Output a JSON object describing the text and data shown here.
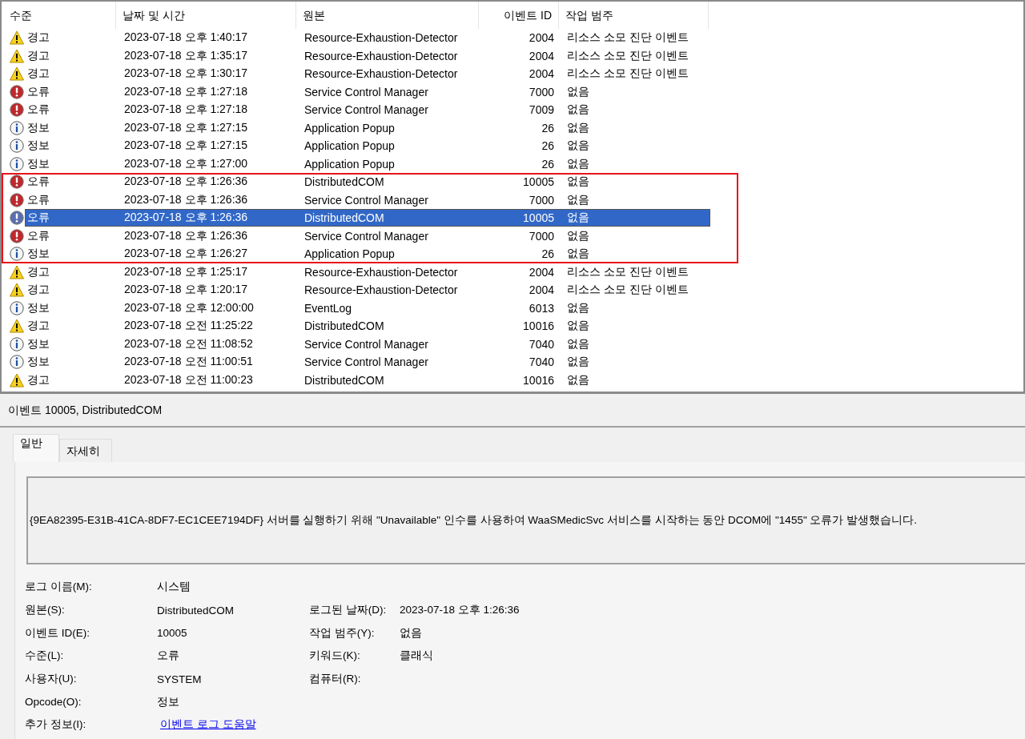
{
  "table": {
    "columns": [
      "수준",
      "날짜 및 시간",
      "원본",
      "이벤트 ID",
      "작업 범주"
    ],
    "rows": [
      {
        "kind": "warning",
        "level": "경고",
        "date": "2023-07-18 오후 1:40:17",
        "source": "Resource-Exhaustion-Detector",
        "id": "2004",
        "category": "리소스 소모 진단 이벤트",
        "selected": false,
        "highlighted": false
      },
      {
        "kind": "warning",
        "level": "경고",
        "date": "2023-07-18 오후 1:35:17",
        "source": "Resource-Exhaustion-Detector",
        "id": "2004",
        "category": "리소스 소모 진단 이벤트",
        "selected": false,
        "highlighted": false
      },
      {
        "kind": "warning",
        "level": "경고",
        "date": "2023-07-18 오후 1:30:17",
        "source": "Resource-Exhaustion-Detector",
        "id": "2004",
        "category": "리소스 소모 진단 이벤트",
        "selected": false,
        "highlighted": false
      },
      {
        "kind": "error",
        "level": "오류",
        "date": "2023-07-18 오후 1:27:18",
        "source": "Service Control Manager",
        "id": "7000",
        "category": "없음",
        "selected": false,
        "highlighted": false
      },
      {
        "kind": "error",
        "level": "오류",
        "date": "2023-07-18 오후 1:27:18",
        "source": "Service Control Manager",
        "id": "7009",
        "category": "없음",
        "selected": false,
        "highlighted": false
      },
      {
        "kind": "info",
        "level": "정보",
        "date": "2023-07-18 오후 1:27:15",
        "source": "Application Popup",
        "id": "26",
        "category": "없음",
        "selected": false,
        "highlighted": false
      },
      {
        "kind": "info",
        "level": "정보",
        "date": "2023-07-18 오후 1:27:15",
        "source": "Application Popup",
        "id": "26",
        "category": "없음",
        "selected": false,
        "highlighted": false
      },
      {
        "kind": "info",
        "level": "정보",
        "date": "2023-07-18 오후 1:27:00",
        "source": "Application Popup",
        "id": "26",
        "category": "없음",
        "selected": false,
        "highlighted": false
      },
      {
        "kind": "error",
        "level": "오류",
        "date": "2023-07-18 오후 1:26:36",
        "source": "DistributedCOM",
        "id": "10005",
        "category": "없음",
        "selected": false,
        "highlighted": true
      },
      {
        "kind": "error",
        "level": "오류",
        "date": "2023-07-18 오후 1:26:36",
        "source": "Service Control Manager",
        "id": "7000",
        "category": "없음",
        "selected": false,
        "highlighted": true
      },
      {
        "kind": "error",
        "level": "오류",
        "date": "2023-07-18 오후 1:26:36",
        "source": "DistributedCOM",
        "id": "10005",
        "category": "없음",
        "selected": true,
        "highlighted": true
      },
      {
        "kind": "error",
        "level": "오류",
        "date": "2023-07-18 오후 1:26:36",
        "source": "Service Control Manager",
        "id": "7000",
        "category": "없음",
        "selected": false,
        "highlighted": true
      },
      {
        "kind": "info",
        "level": "정보",
        "date": "2023-07-18 오후 1:26:27",
        "source": "Application Popup",
        "id": "26",
        "category": "없음",
        "selected": false,
        "highlighted": true
      },
      {
        "kind": "warning",
        "level": "경고",
        "date": "2023-07-18 오후 1:25:17",
        "source": "Resource-Exhaustion-Detector",
        "id": "2004",
        "category": "리소스 소모 진단 이벤트",
        "selected": false,
        "highlighted": false
      },
      {
        "kind": "warning",
        "level": "경고",
        "date": "2023-07-18 오후 1:20:17",
        "source": "Resource-Exhaustion-Detector",
        "id": "2004",
        "category": "리소스 소모 진단 이벤트",
        "selected": false,
        "highlighted": false
      },
      {
        "kind": "info",
        "level": "정보",
        "date": "2023-07-18 오후 12:00:00",
        "source": "EventLog",
        "id": "6013",
        "category": "없음",
        "selected": false,
        "highlighted": false
      },
      {
        "kind": "warning",
        "level": "경고",
        "date": "2023-07-18 오전 11:25:22",
        "source": "DistributedCOM",
        "id": "10016",
        "category": "없음",
        "selected": false,
        "highlighted": false
      },
      {
        "kind": "info",
        "level": "정보",
        "date": "2023-07-18 오전 11:08:52",
        "source": "Service Control Manager",
        "id": "7040",
        "category": "없음",
        "selected": false,
        "highlighted": false
      },
      {
        "kind": "info",
        "level": "정보",
        "date": "2023-07-18 오전 11:00:51",
        "source": "Service Control Manager",
        "id": "7040",
        "category": "없음",
        "selected": false,
        "highlighted": false
      },
      {
        "kind": "warning",
        "level": "경고",
        "date": "2023-07-18 오전 11:00:23",
        "source": "DistributedCOM",
        "id": "10016",
        "category": "없음",
        "selected": false,
        "highlighted": false
      }
    ]
  },
  "details": {
    "title": "이벤트 10005, DistributedCOM",
    "tabs": [
      {
        "label": "일반",
        "selected": true
      },
      {
        "label": "자세히",
        "selected": false
      }
    ],
    "message": "{9EA82395-E31B-41CA-8DF7-EC1CEE7194DF} 서버를 실행하기 위해 \"Unavailable\" 인수를 사용하여 WaaSMedicSvc 서비스를 시작하는 동안 DCOM에 \"1455\" 오류가 발생했습니다.",
    "properties": [
      {
        "left": {
          "label": "로그 이름(M):",
          "value": "시스템",
          "kind": "text"
        }
      },
      {
        "left": {
          "label": "원본(S):",
          "value": "DistributedCOM",
          "kind": "text"
        },
        "right": {
          "label": "로그된 날짜(D):",
          "value": "2023-07-18 오후 1:26:36"
        }
      },
      {
        "left": {
          "label": "이벤트 ID(E):",
          "value": "10005",
          "kind": "text"
        },
        "right": {
          "label": "작업 범주(Y):",
          "value": "없음"
        }
      },
      {
        "left": {
          "label": "수준(L):",
          "value": "오류",
          "kind": "text"
        },
        "right": {
          "label": "키워드(K):",
          "value": "클래식"
        }
      },
      {
        "left": {
          "label": "사용자(U):",
          "value": "SYSTEM",
          "kind": "text"
        },
        "right": {
          "label": "컴퓨터(R):"
        }
      },
      {
        "left": {
          "label": "Opcode(O):",
          "value": "정보",
          "kind": "text"
        }
      },
      {
        "left": {
          "label": "추가 정보(I):",
          "value": "이벤트 로그 도움말",
          "kind": "link"
        }
      }
    ]
  }
}
